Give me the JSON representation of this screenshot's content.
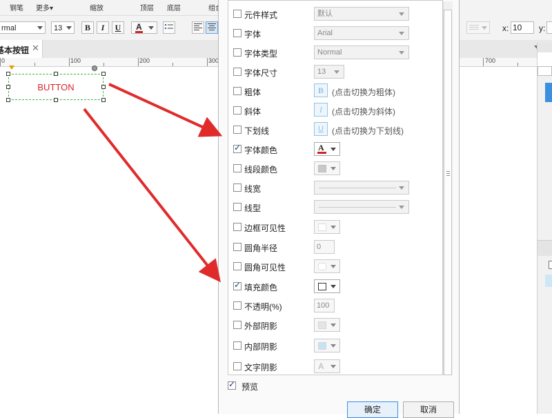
{
  "toolbar": {
    "labels": {
      "brush": "钢笔",
      "more": "更多▾",
      "zoom": "缩放",
      "top": "顶层",
      "bottom": "底层",
      "group": "组合"
    },
    "font_name": "rmal",
    "font_size": "13",
    "bold": "B",
    "italic": "I",
    "underline": "U",
    "font_color_glyph": "A",
    "x_label": "x:",
    "x_value": "10",
    "y_label": "y:"
  },
  "tab": {
    "label": "基本按钮"
  },
  "ruler": {
    "marks": [
      "0",
      "100",
      "200",
      "300",
      "700"
    ]
  },
  "canvas": {
    "button_text": "BUTTON"
  },
  "dialog": {
    "rows": [
      {
        "id": "widget-style",
        "label": "元件样式",
        "checked": false,
        "control": "select",
        "value": "默认"
      },
      {
        "id": "font",
        "label": "字体",
        "checked": false,
        "control": "select",
        "value": "Arial"
      },
      {
        "id": "font-type",
        "label": "字体类型",
        "checked": false,
        "control": "select",
        "value": "Normal"
      },
      {
        "id": "font-size",
        "label": "字体尺寸",
        "checked": false,
        "control": "select-small",
        "value": "13"
      },
      {
        "id": "bold",
        "label": "粗体",
        "checked": false,
        "control": "style",
        "glyph": "B",
        "hint": "(点击切换为粗体)"
      },
      {
        "id": "italic",
        "label": "斜体",
        "checked": false,
        "control": "style",
        "glyph": "I",
        "hint": "(点击切换为斜体)"
      },
      {
        "id": "underline",
        "label": "下划线",
        "checked": false,
        "control": "style",
        "glyph": "U",
        "hint": "(点击切换为下划线)"
      },
      {
        "id": "font-color",
        "label": "字体颜色",
        "checked": true,
        "control": "picker",
        "swatch": "font-color"
      },
      {
        "id": "line-color",
        "label": "线段颜色",
        "checked": false,
        "control": "picker",
        "swatch": "line-color"
      },
      {
        "id": "line-width",
        "label": "线宽",
        "checked": false,
        "control": "line-select"
      },
      {
        "id": "line-type",
        "label": "线型",
        "checked": false,
        "control": "line-select"
      },
      {
        "id": "border-visible",
        "label": "边框可见性",
        "checked": false,
        "control": "picker",
        "swatch": "border"
      },
      {
        "id": "corner-radius",
        "label": "圆角半径",
        "checked": false,
        "control": "number",
        "value": "0"
      },
      {
        "id": "corner-visible",
        "label": "圆角可见性",
        "checked": false,
        "control": "picker",
        "swatch": "corner"
      },
      {
        "id": "fill-color",
        "label": "填充颜色",
        "checked": true,
        "control": "picker",
        "swatch": "fill"
      },
      {
        "id": "opacity",
        "label": "不透明(%)",
        "checked": false,
        "control": "number",
        "value": "100"
      },
      {
        "id": "outer-shadow",
        "label": "外部阴影",
        "checked": false,
        "control": "picker",
        "swatch": "outer-shadow"
      },
      {
        "id": "inner-shadow",
        "label": "内部阴影",
        "checked": false,
        "control": "picker",
        "swatch": "inner-shadow"
      },
      {
        "id": "text-shadow",
        "label": "文字阴影",
        "checked": false,
        "control": "picker",
        "swatch": "text-shadow"
      }
    ],
    "preview": {
      "label": "预览",
      "checked": true
    },
    "ok_label": "确定",
    "cancel_label": "取消"
  },
  "colors": {
    "accent": "#3c8ede",
    "annotation": "#e02b2b",
    "button_text": "#d9232a",
    "font_color_bar": "#d32020",
    "dashed_border": "#3cb43c"
  }
}
